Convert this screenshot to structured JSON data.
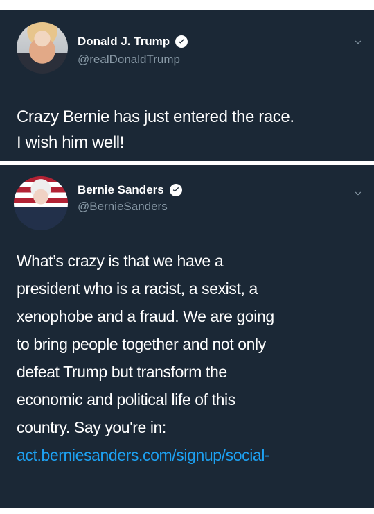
{
  "tweets": [
    {
      "name": "Donald J. Trump",
      "handle": "@realDonaldTrump",
      "lines": [
        "Crazy Bernie has just entered the race.",
        "I wish him well!"
      ]
    },
    {
      "name": "Bernie Sanders",
      "handle": "@BernieSanders",
      "lines": [
        "What’s crazy is that we have a",
        "president who is a racist, a sexist, a",
        "xenophobe and a fraud. We are going",
        "to bring people together and not only",
        "defeat Trump but transform the",
        "economic and political life of this",
        "country. Say you're in:"
      ],
      "link": "act.berniesanders.com/signup/social-"
    }
  ],
  "colors": {
    "background": "#1b2836",
    "text": "#ffffff",
    "muted": "#8899a6",
    "link": "#1da1f2"
  },
  "icons": {
    "verified": "verified-badge-icon",
    "chevron": "chevron-down-icon"
  }
}
